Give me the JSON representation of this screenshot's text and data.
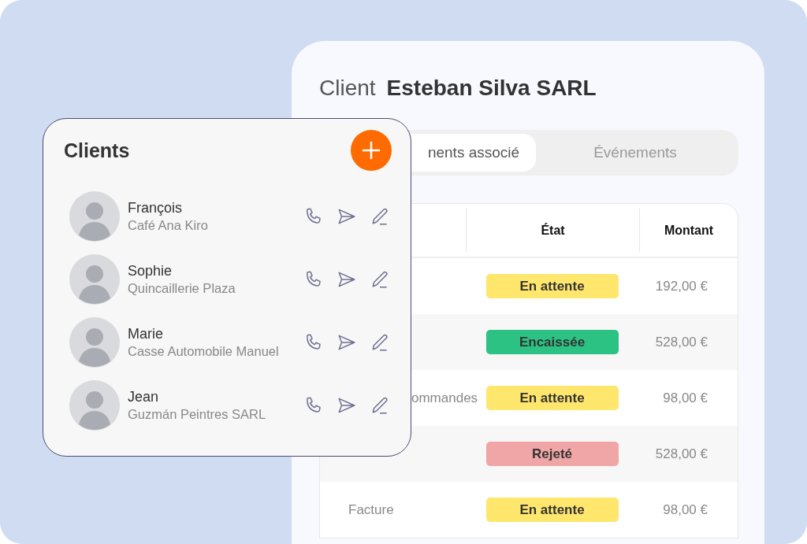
{
  "client_panel": {
    "label": "Client",
    "name": "Esteban Silva SARL"
  },
  "tabs": [
    {
      "label": "nents associé",
      "selected": true
    },
    {
      "label": "Événements",
      "selected": false
    }
  ],
  "table": {
    "columns": [
      "État",
      "Montant"
    ],
    "rows": [
      {
        "state": "En attente",
        "color": "#ffe66d",
        "amount": "192,00 €"
      },
      {
        "state": "Encaissée",
        "color": "#2bc283",
        "amount": "528,00 €"
      },
      {
        "document": "ommandes",
        "state": "En attente",
        "color": "#ffe66d",
        "amount": "98,00 €"
      },
      {
        "state": "Rejeté",
        "color": "#f0a6a6",
        "amount": "528,00 €"
      },
      {
        "document": "Facture",
        "state": "En attente",
        "color": "#ffe66d",
        "amount": "98,00 €"
      }
    ]
  },
  "clients_card": {
    "title": "Clients",
    "clients": [
      {
        "name": "François",
        "company": "Café Ana Kiro"
      },
      {
        "name": "Sophie",
        "company": "Quincaillerie Plaza"
      },
      {
        "name": "Marie",
        "company": "Casse Automobile Manuel"
      },
      {
        "name": "Jean",
        "company": "Guzmán Peintres SARL"
      }
    ]
  }
}
